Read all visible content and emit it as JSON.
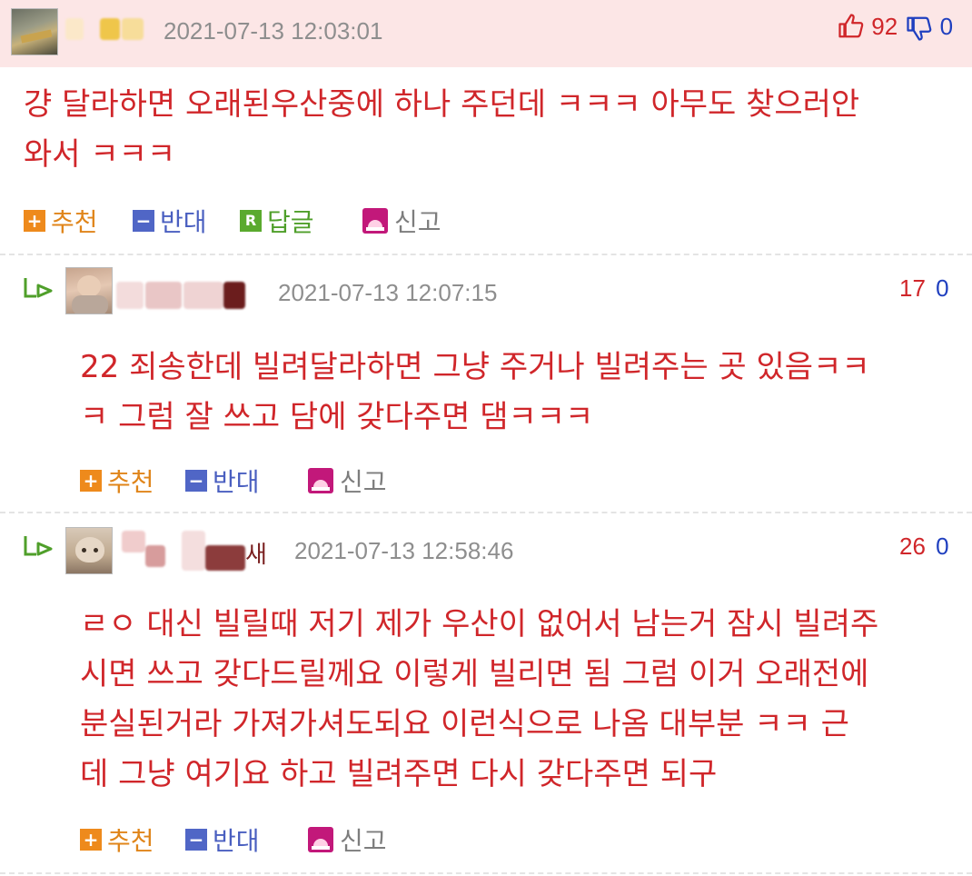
{
  "comments": [
    {
      "timestamp": "2021-07-13 12:03:01",
      "likes": "92",
      "dislikes": "0",
      "lines": [
        "걍 달라하면 오래된우산중에 하나 주던데 ㅋㅋㅋ 아무도 찾으러안",
        "와서 ㅋㅋㅋ"
      ],
      "actions": {
        "recommend": "추천",
        "oppose": "반대",
        "reply": "답글",
        "report": "신고"
      }
    },
    {
      "name_fragment": "",
      "timestamp": "2021-07-13 12:07:15",
      "likes": "17",
      "dislikes": "0",
      "lines": [
        "22 죄송한데 빌려달라하면 그냥 주거나 빌려주는 곳 있음ㅋㅋ",
        "ㅋ 그럼 잘 쓰고 담에 갖다주면 댐ㅋㅋㅋ"
      ],
      "actions": {
        "recommend": "추천",
        "oppose": "반대",
        "report": "신고"
      }
    },
    {
      "name_fragment": "새",
      "timestamp": "2021-07-13 12:58:46",
      "likes": "26",
      "dislikes": "0",
      "lines": [
        "ㄹㅇ 대신 빌릴때 저기 제가 우산이 없어서 남는거 잠시 빌려주",
        "시면 쓰고 갖다드릴께요 이렇게 빌리면 됨 그럼 이거 오래전에",
        "분실된거라 가져가셔도되요 이런식으로 나옴 대부분 ㅋㅋ 근",
        "데 그냥 여기요 하고 빌려주면 다시 갖다주면 되구"
      ],
      "actions": {
        "recommend": "추천",
        "oppose": "반대",
        "report": "신고"
      }
    }
  ],
  "icons": {
    "vote_up": "thumb-up-icon",
    "vote_down": "thumb-down-icon",
    "reply_arrow": "reply-arrow-icon",
    "plus": "plus-icon",
    "minus": "minus-icon",
    "reply_badge": "reply-r-icon",
    "report": "siren-icon"
  },
  "colors": {
    "text_red": "#d0262a",
    "highlight_bg": "#fce6e6",
    "recommend": "#e0851a",
    "oppose": "#4a5fc0",
    "reply": "#4f9f2a",
    "report": "#7d7d7d",
    "timestamp": "#8e8e8e"
  }
}
